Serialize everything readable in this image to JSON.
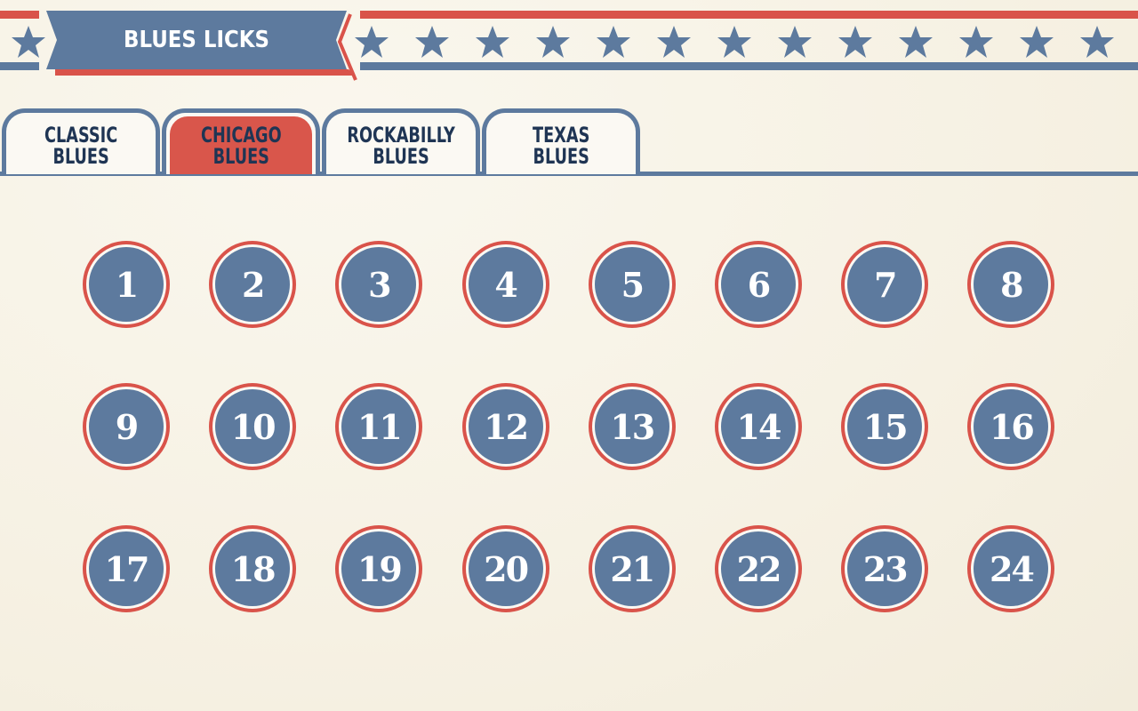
{
  "header": {
    "title": "BLUES LICKS",
    "decoration_icon": "star-icon",
    "colors": {
      "red": "#d9534a",
      "blue": "#5d7a9e",
      "background": "#f6f1e3"
    }
  },
  "tabs": [
    {
      "label": "CLASSIC\nBLUES",
      "active": false
    },
    {
      "label": "CHICAGO\nBLUES",
      "active": true
    },
    {
      "label": "ROCKABILLY\nBLUES",
      "active": false
    },
    {
      "label": "TEXAS\nBLUES",
      "active": false
    }
  ],
  "licks": [
    "1",
    "2",
    "3",
    "4",
    "5",
    "6",
    "7",
    "8",
    "9",
    "10",
    "11",
    "12",
    "13",
    "14",
    "15",
    "16",
    "17",
    "18",
    "19",
    "20",
    "21",
    "22",
    "23",
    "24"
  ]
}
